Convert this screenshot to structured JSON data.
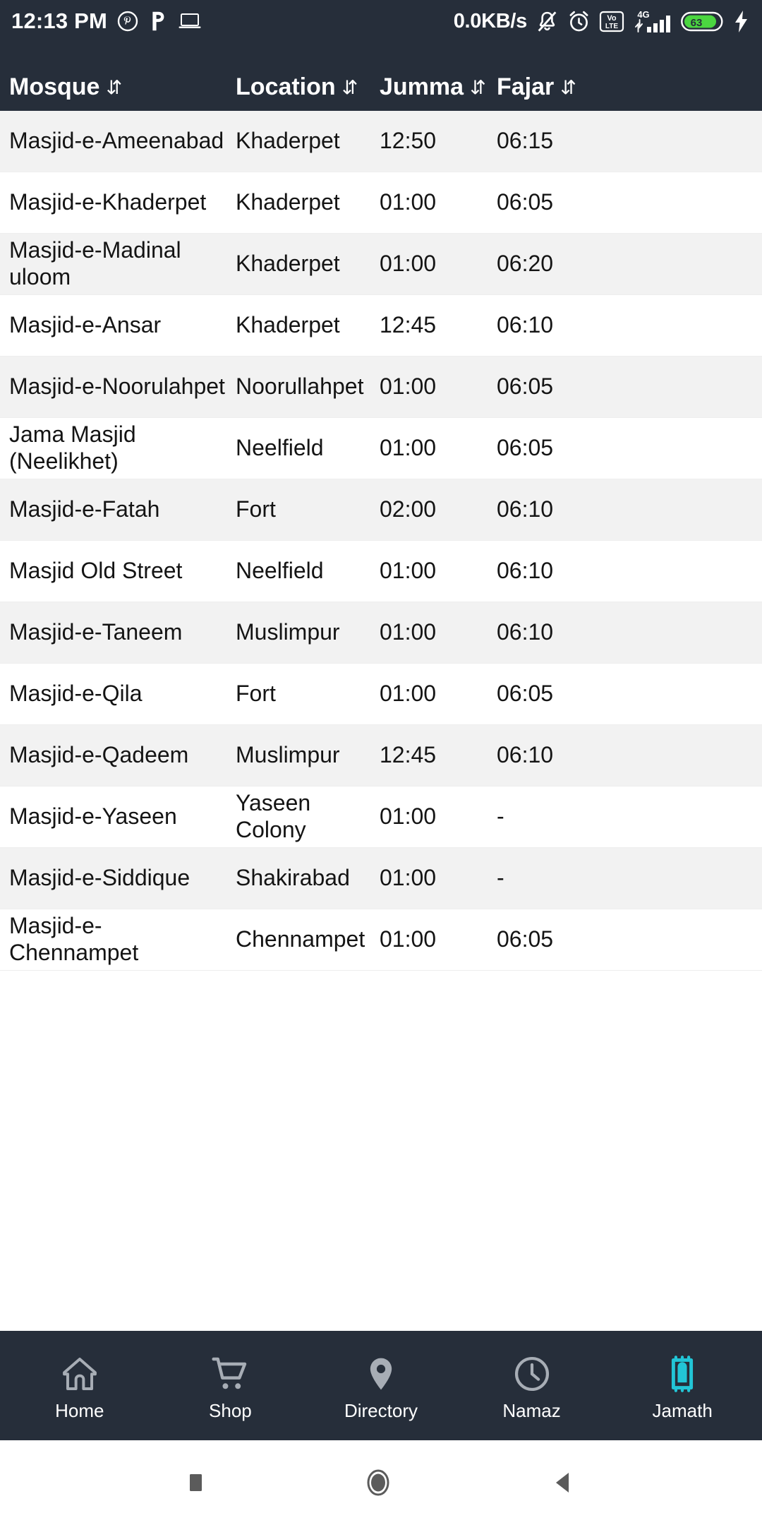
{
  "status_bar": {
    "time": "12:13 PM",
    "network_speed": "0.0KB/s",
    "battery_percent": "63",
    "signal_label": "4G",
    "volte_top": "Vo",
    "volte_bottom": "LTE",
    "icons": [
      "pinterest-icon",
      "p-app-icon",
      "laptop-icon",
      "bell-muted-icon",
      "alarm-clock-icon",
      "volte-icon",
      "signal-bars-icon",
      "battery-icon",
      "charging-bolt-icon"
    ]
  },
  "table": {
    "sort_glyph": "⇵",
    "columns": [
      {
        "label": "Mosque",
        "key": "mosque"
      },
      {
        "label": "Location",
        "key": "location"
      },
      {
        "label": "Jumma",
        "key": "jumma"
      },
      {
        "label": "Fajar",
        "key": "fajar"
      }
    ],
    "rows": [
      {
        "mosque": "Masjid-e-Ameenabad",
        "location": "Khaderpet",
        "jumma": "12:50",
        "fajar": "06:15"
      },
      {
        "mosque": "Masjid-e-Khaderpet",
        "location": "Khaderpet",
        "jumma": "01:00",
        "fajar": "06:05"
      },
      {
        "mosque": "Masjid-e-Madinal uloom",
        "location": "Khaderpet",
        "jumma": "01:00",
        "fajar": "06:20"
      },
      {
        "mosque": "Masjid-e-Ansar",
        "location": "Khaderpet",
        "jumma": "12:45",
        "fajar": "06:10"
      },
      {
        "mosque": "Masjid-e-Noorulahpet",
        "location": "Noorullahpet",
        "jumma": "01:00",
        "fajar": "06:05"
      },
      {
        "mosque": "Jama Masjid (Neelikhet)",
        "location": "Neelfield",
        "jumma": "01:00",
        "fajar": "06:05"
      },
      {
        "mosque": "Masjid-e-Fatah",
        "location": "Fort",
        "jumma": "02:00",
        "fajar": "06:10"
      },
      {
        "mosque": "Masjid Old Street",
        "location": "Neelfield",
        "jumma": "01:00",
        "fajar": "06:10"
      },
      {
        "mosque": "Masjid-e-Taneem",
        "location": "Muslimpur",
        "jumma": "01:00",
        "fajar": "06:10"
      },
      {
        "mosque": "Masjid-e-Qila",
        "location": "Fort",
        "jumma": "01:00",
        "fajar": "06:05"
      },
      {
        "mosque": "Masjid-e-Qadeem",
        "location": "Muslimpur",
        "jumma": "12:45",
        "fajar": "06:10"
      },
      {
        "mosque": "Masjid-e-Yaseen",
        "location": "Yaseen Colony",
        "jumma": "01:00",
        "fajar": "-"
      },
      {
        "mosque": "Masjid-e-Siddique",
        "location": "Shakirabad",
        "jumma": "01:00",
        "fajar": "-"
      },
      {
        "mosque": "Masjid-e-Chennampet",
        "location": "Chennampet",
        "jumma": "01:00",
        "fajar": "06:05"
      }
    ]
  },
  "bottom_nav": {
    "active_index": 4,
    "active_color": "#22c5d6",
    "inactive_color": "#a7adb5",
    "items": [
      {
        "label": "Home",
        "icon": "home-icon"
      },
      {
        "label": "Shop",
        "icon": "cart-icon"
      },
      {
        "label": "Directory",
        "icon": "map-pin-icon"
      },
      {
        "label": "Namaz",
        "icon": "clock-icon"
      },
      {
        "label": "Jamath",
        "icon": "prayer-mat-icon"
      }
    ]
  },
  "system_nav": {
    "buttons": [
      "recents-square-icon",
      "home-circle-icon",
      "back-triangle-icon"
    ]
  },
  "colors": {
    "header_bg": "#262e3a",
    "row_alt_bg": "#f2f2f2",
    "row_bg": "#ffffff",
    "text": "#141414"
  }
}
